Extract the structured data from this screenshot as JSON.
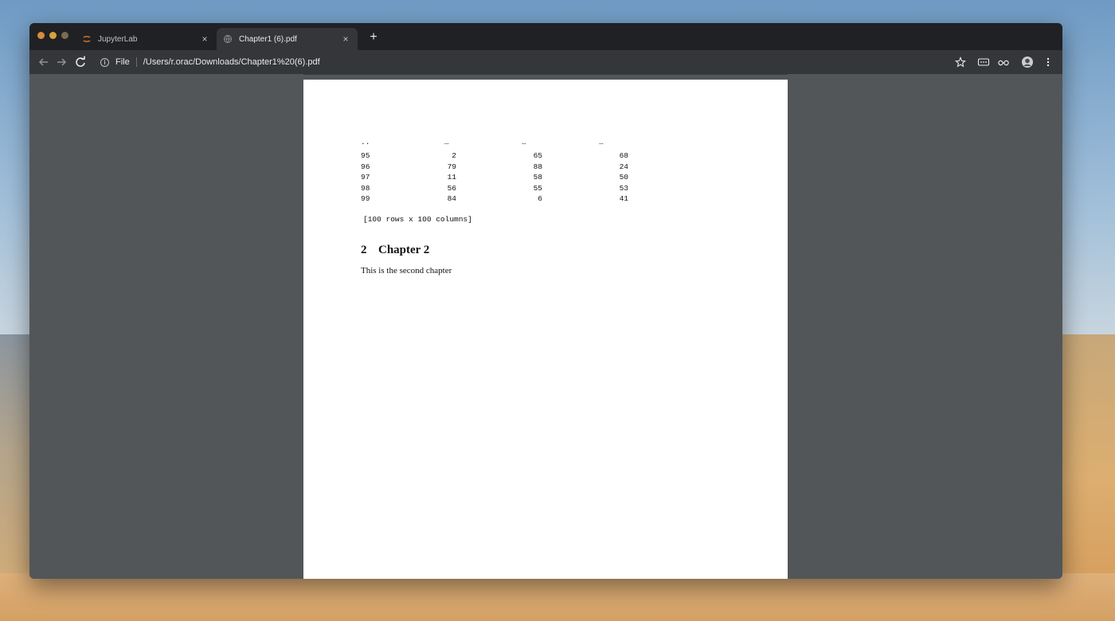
{
  "browser": {
    "tabs": [
      {
        "title": "JupyterLab",
        "close": "×"
      },
      {
        "title": "Chapter1 (6).pdf",
        "close": "×"
      }
    ],
    "new_tab": "+",
    "address": {
      "scheme": "File",
      "url": "/Users/r.orac/Downloads/Chapter1%20(6).pdf"
    },
    "icons": [
      "back-icon",
      "forward-icon",
      "reload-icon",
      "info-icon",
      "star-icon",
      "extension-icon",
      "incognito-icon",
      "profile-icon",
      "menu-icon"
    ]
  },
  "document": {
    "table_dots": [
      "..",
      "…",
      "…",
      "…"
    ],
    "table_rows": [
      [
        "95",
        "2",
        "65",
        "68"
      ],
      [
        "96",
        "79",
        "88",
        "24"
      ],
      [
        "97",
        "11",
        "58",
        "50"
      ],
      [
        "98",
        "56",
        "55",
        "53"
      ],
      [
        "99",
        "84",
        "6",
        "41"
      ]
    ],
    "summary": "[100 rows x 100 columns]",
    "chapter": {
      "number": "2",
      "title": "Chapter 2"
    },
    "body": "This is the second chapter"
  },
  "colors": {
    "tab_strip": "#202124",
    "toolbar": "#35363a",
    "viewer_background": "#525659",
    "page": "#ffffff"
  }
}
